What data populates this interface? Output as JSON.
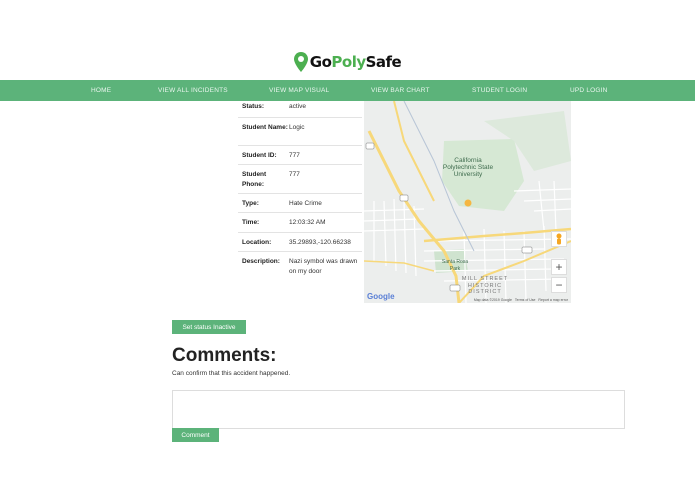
{
  "brand": {
    "part1": "Go",
    "part2": "Poly",
    "part3": "Safe",
    "accent_color": "#5cb37a",
    "logo_icon": "map-pin-icon"
  },
  "nav": {
    "items": [
      {
        "label": "HOME"
      },
      {
        "label": "VIEW ALL INCIDENTS"
      },
      {
        "label": "VIEW MAP VISUAL"
      },
      {
        "label": "VIEW BAR CHART"
      },
      {
        "label": "STUDENT LOGIN"
      },
      {
        "label": "UPD LOGIN"
      }
    ]
  },
  "incident": {
    "rows": [
      {
        "label": "Status:",
        "value": "active"
      },
      {
        "label": "Student Name:",
        "value": "Logic"
      },
      {
        "label": "Student ID:",
        "value": "777"
      },
      {
        "label": "Student Phone:",
        "value": "777"
      },
      {
        "label": "Type:",
        "value": "Hate Crime"
      },
      {
        "label": "Time:",
        "value": "12:03:32 AM"
      },
      {
        "label": "Location:",
        "value": "35.29893,-120.66238"
      },
      {
        "label": "Description:",
        "value": "Nazi symbol was drawn on my door"
      }
    ]
  },
  "map": {
    "campus_label": "California Polytechnic State University",
    "park_label": "Santa Rosa Park",
    "district_label": "MILL STREET HISTORIC DISTRICT",
    "google_label": "Google",
    "footer_data": "Map data ©2019 Google",
    "footer_terms": "Terms of Use",
    "footer_report": "Report a map error",
    "zoom_in": "+",
    "zoom_out": "−"
  },
  "actions": {
    "status_button": "Set status Inactive"
  },
  "comments": {
    "title": "Comments:",
    "items": [
      "Can confirm that this accident happened."
    ],
    "input_placeholder": "",
    "submit_label": "Comment"
  }
}
